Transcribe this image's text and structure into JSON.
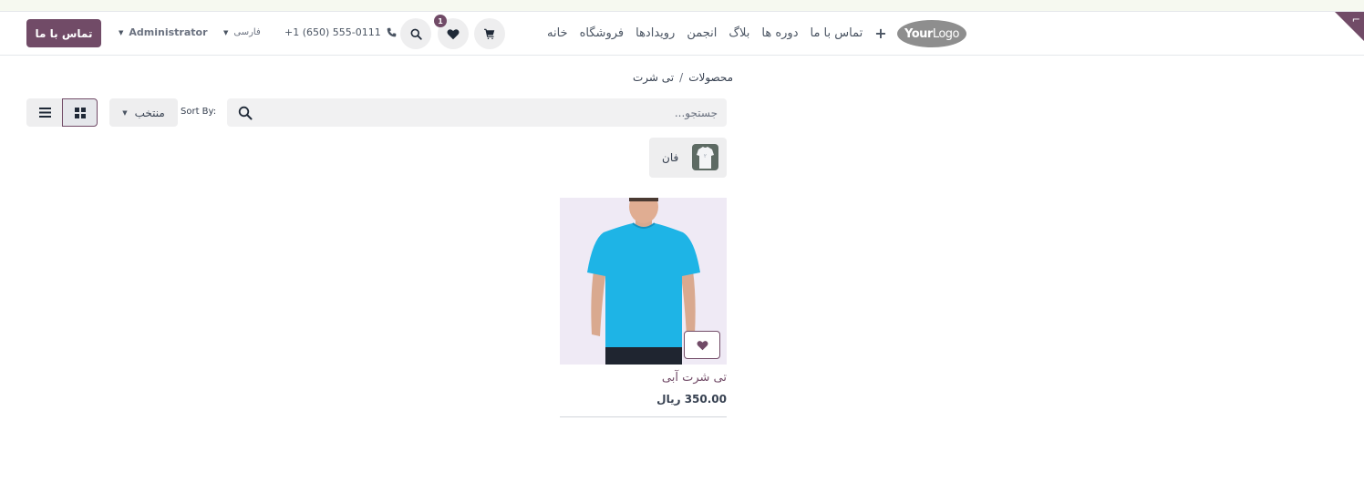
{
  "header": {
    "contact_button": "تماس با ما",
    "user": "Administrator",
    "language": "فارسی",
    "phone": "+1 (650) 555-0111",
    "wishlist_count": "1",
    "nav": [
      "خانه",
      "فروشگاه",
      "رویدادها",
      "انجمن",
      "بلاگ",
      "دوره ها",
      "تماس با ما"
    ],
    "logo": {
      "bold": "Your",
      "light": "Logo"
    }
  },
  "breadcrumb": {
    "root": "محصولات",
    "separator": "/",
    "current": "تی شرت"
  },
  "toolbar": {
    "search_placeholder": "جستجو...",
    "sort_label": "Sort By:",
    "sort_value": "منتخب"
  },
  "attribute_filter": {
    "label": "فان"
  },
  "products": [
    {
      "name": "تی شرت آبی",
      "price": "350.00 ریال"
    }
  ],
  "colors": {
    "accent": "#714b67",
    "shirt": "#1eb4e6"
  }
}
